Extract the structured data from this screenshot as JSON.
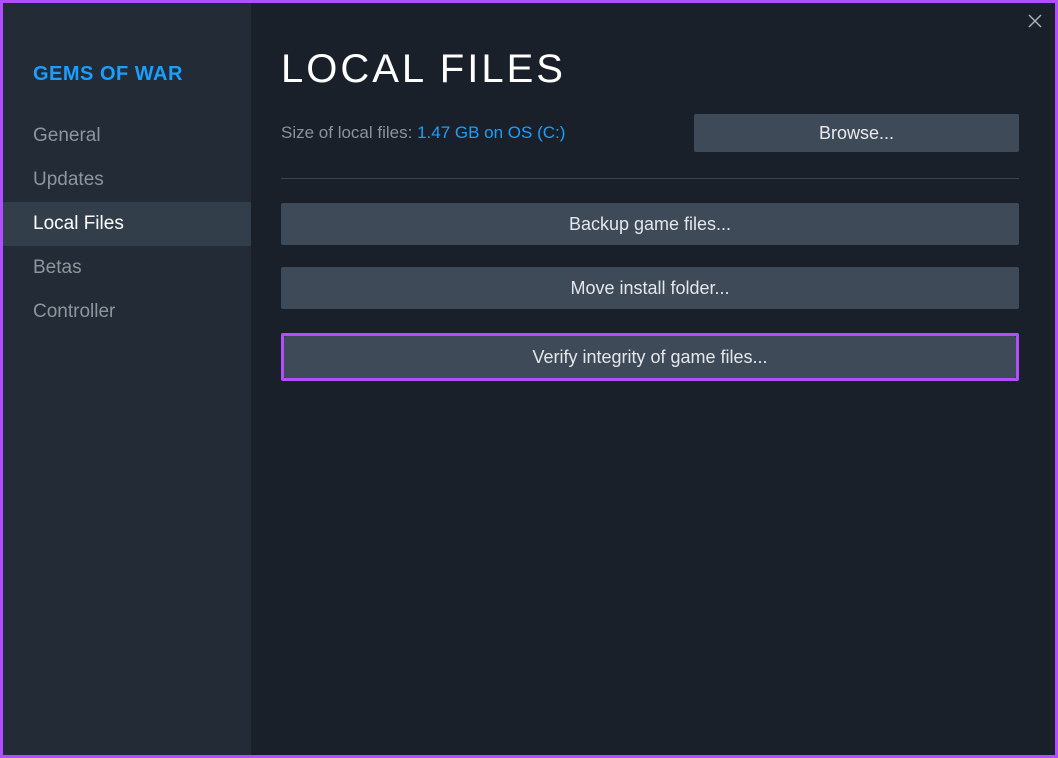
{
  "sidebar": {
    "title": "GEMS OF WAR",
    "items": [
      {
        "label": "General"
      },
      {
        "label": "Updates"
      },
      {
        "label": "Local Files"
      },
      {
        "label": "Betas"
      },
      {
        "label": "Controller"
      }
    ]
  },
  "main": {
    "title": "LOCAL FILES",
    "size_label": "Size of local files: ",
    "size_value": "1.47 GB on OS (C:)",
    "browse_label": "Browse...",
    "backup_label": "Backup game files...",
    "move_label": "Move install folder...",
    "verify_label": "Verify integrity of game files..."
  }
}
